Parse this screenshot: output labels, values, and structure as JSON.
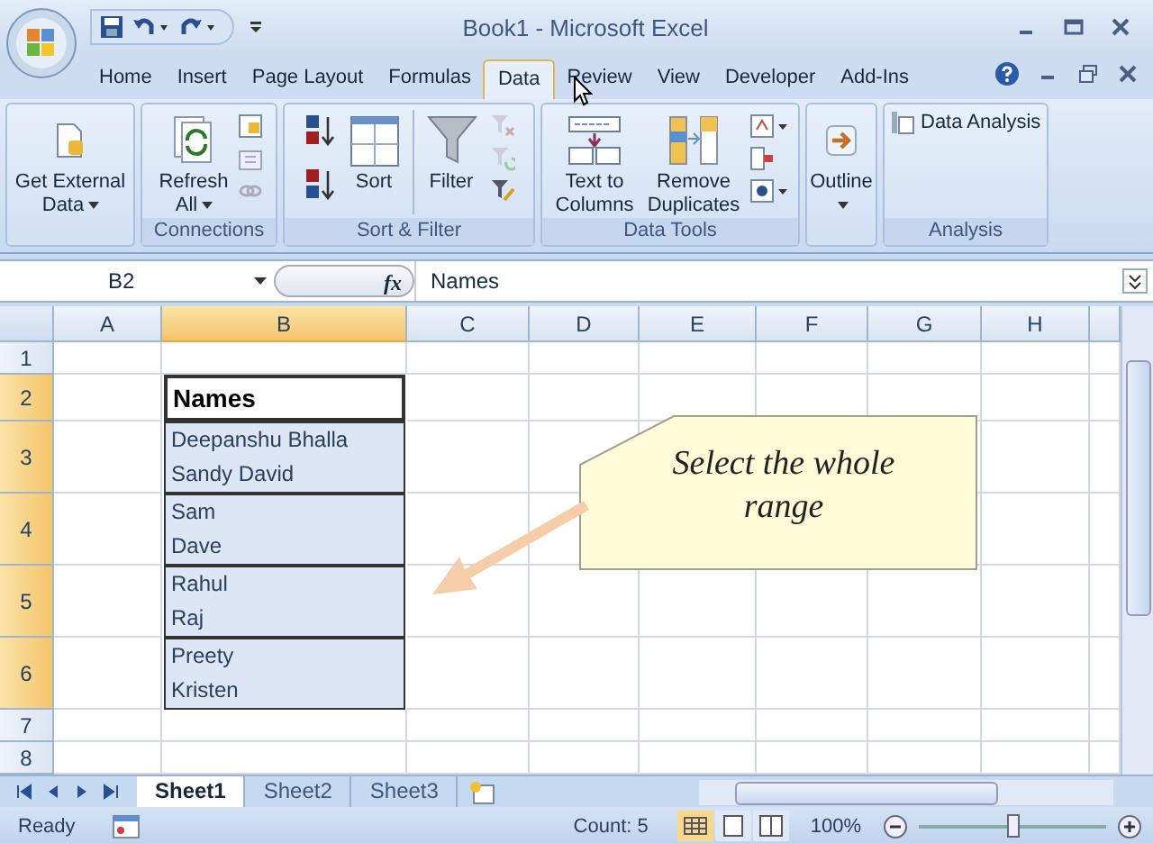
{
  "window": {
    "title": "Book1 - Microsoft Excel"
  },
  "tabs": [
    {
      "label": "Home",
      "selected": false
    },
    {
      "label": "Insert",
      "selected": false
    },
    {
      "label": "Page Layout",
      "selected": false
    },
    {
      "label": "Formulas",
      "selected": false
    },
    {
      "label": "Data",
      "selected": true
    },
    {
      "label": "Review",
      "selected": false
    },
    {
      "label": "View",
      "selected": false
    },
    {
      "label": "Developer",
      "selected": false
    },
    {
      "label": "Add-Ins",
      "selected": false
    }
  ],
  "ribbon": {
    "groups": [
      {
        "buttons": [
          {
            "label": "Get External Data",
            "dropdown": true
          }
        ]
      },
      {
        "label": "Connections",
        "buttons": [
          {
            "label": "Refresh All",
            "dropdown": true
          }
        ]
      },
      {
        "label": "Sort & Filter",
        "buttons": [
          {
            "label": "Sort"
          },
          {
            "label": "Filter"
          }
        ]
      },
      {
        "label": "Data Tools",
        "buttons": [
          {
            "label": "Text to Columns"
          },
          {
            "label": "Remove Duplicates"
          }
        ]
      },
      {
        "buttons": [
          {
            "label": "Outline",
            "dropdown": true
          }
        ]
      },
      {
        "label": "Analysis",
        "buttons": [
          {
            "label": "Data Analysis"
          }
        ]
      }
    ]
  },
  "formula_bar": {
    "name_box": "B2",
    "function_label": "fx",
    "value": "Names"
  },
  "sheet": {
    "columns": [
      {
        "label": "A",
        "selected": false
      },
      {
        "label": "B",
        "selected": true
      },
      {
        "label": "C",
        "selected": false
      },
      {
        "label": "D",
        "selected": false
      },
      {
        "label": "E",
        "selected": false
      },
      {
        "label": "F",
        "selected": false
      },
      {
        "label": "G",
        "selected": false
      },
      {
        "label": "H",
        "selected": false
      }
    ],
    "rows": [
      {
        "number": "1",
        "selected": false
      },
      {
        "number": "2",
        "selected": true,
        "cell_b": {
          "kind": "header",
          "selected": false,
          "lines": [
            "Names"
          ]
        }
      },
      {
        "number": "3",
        "selected": true,
        "cell_b": {
          "kind": "names",
          "selected": true,
          "lines": [
            "Deepanshu Bhalla",
            "Sandy David"
          ]
        }
      },
      {
        "number": "4",
        "selected": true,
        "cell_b": {
          "kind": "names",
          "selected": true,
          "lines": [
            "Sam",
            "Dave"
          ]
        }
      },
      {
        "number": "5",
        "selected": true,
        "cell_b": {
          "kind": "names",
          "selected": true,
          "lines": [
            "Rahul",
            "Raj"
          ]
        }
      },
      {
        "number": "6",
        "selected": true,
        "cell_b": {
          "kind": "names",
          "selected": true,
          "lines": [
            "Preety",
            "Kristen"
          ]
        }
      },
      {
        "number": "7",
        "selected": false
      },
      {
        "number": "8",
        "selected": false
      }
    ]
  },
  "callout": {
    "text": "Select the whole range"
  },
  "sheet_tabs": [
    {
      "label": "Sheet1",
      "selected": true
    },
    {
      "label": "Sheet2",
      "selected": false
    },
    {
      "label": "Sheet3",
      "selected": false
    }
  ],
  "status_bar": {
    "status": "Ready",
    "count": "Count: 5",
    "zoom": "100%",
    "zoom_slider": {
      "level": 0.5
    }
  }
}
